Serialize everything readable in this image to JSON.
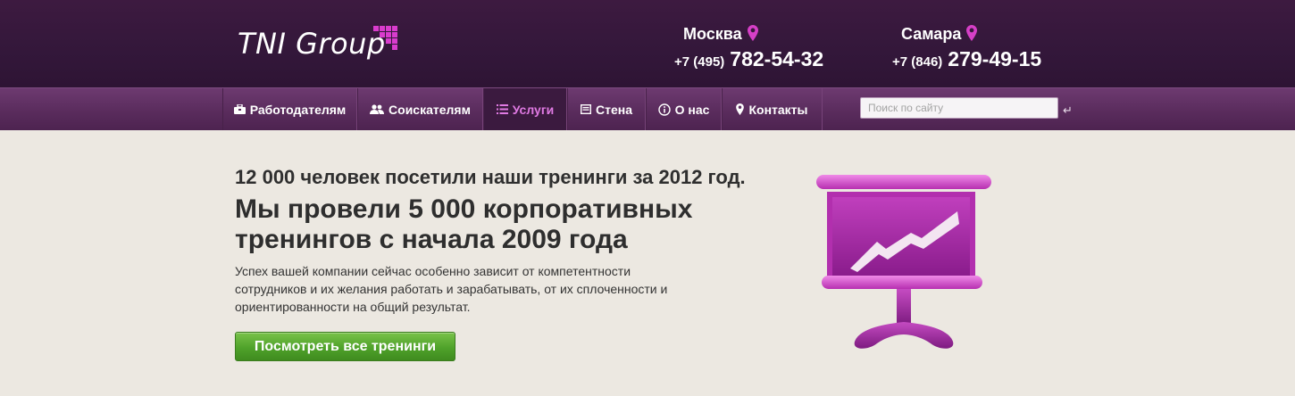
{
  "header": {
    "logo_text": "TNI Group",
    "offices": [
      {
        "city": "Москва",
        "code": "+7 (495)",
        "number": "782-54-32"
      },
      {
        "city": "Самара",
        "code": "+7 (846)",
        "number": "279-49-15"
      }
    ]
  },
  "nav": {
    "items": [
      {
        "label": "Работодателям",
        "icon": "briefcase-icon",
        "active": false
      },
      {
        "label": "Соискателям",
        "icon": "users-icon",
        "active": false
      },
      {
        "label": "Услуги",
        "icon": "list-icon",
        "active": true
      },
      {
        "label": "Стена",
        "icon": "wall-icon",
        "active": false
      },
      {
        "label": "О нас",
        "icon": "info-icon",
        "active": false
      },
      {
        "label": "Контакты",
        "icon": "map-pin-icon",
        "active": false
      }
    ],
    "search": {
      "placeholder": "Поиск по сайту",
      "value": ""
    },
    "submit_glyph": "↵"
  },
  "main": {
    "subtitle": "12 000 человек посетили наши тренинги за 2012 год.",
    "headline": "Мы провели 5 000 корпоративных тренингов с начала 2009 года",
    "description": "Успех вашей компании сейчас особенно зависит от компетентности сотрудников и их желания работать и зарабатывать, от их сплоченности и ориентированности на общий результат.",
    "cta_label": "Посмотреть все тренинги"
  },
  "colors": {
    "header_bg": "#33173a",
    "nav_bg": "#5a2c5d",
    "accent_pink": "#d63fc7",
    "cta_green": "#4fa22a"
  }
}
